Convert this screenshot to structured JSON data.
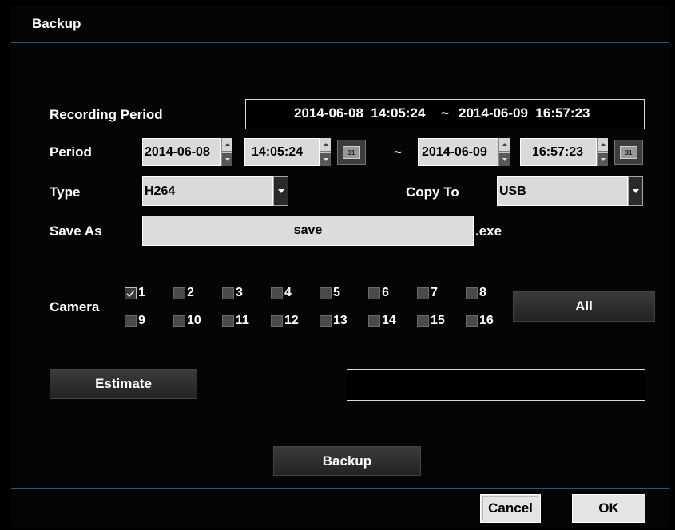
{
  "dialog": {
    "title": "Backup"
  },
  "recording_period": {
    "label": "Recording Period",
    "start": "2014-06-08  14:05:24",
    "sep": "~",
    "end": "2014-06-09  16:57:23"
  },
  "period": {
    "label": "Period",
    "start_date": "2014-06-08",
    "start_time": "14:05:24",
    "tilde": "~",
    "end_date": "2014-06-09",
    "end_time": "16:57:23",
    "calendar_glyph": "31"
  },
  "type": {
    "label": "Type",
    "value": "H264"
  },
  "copy_to": {
    "label": "Copy To",
    "value": "USB"
  },
  "save_as": {
    "label": "Save As",
    "value": "save",
    "ext": ".exe"
  },
  "camera": {
    "label": "Camera",
    "channels": [
      {
        "n": "1",
        "checked": true
      },
      {
        "n": "2",
        "checked": false
      },
      {
        "n": "3",
        "checked": false
      },
      {
        "n": "4",
        "checked": false
      },
      {
        "n": "5",
        "checked": false
      },
      {
        "n": "6",
        "checked": false
      },
      {
        "n": "7",
        "checked": false
      },
      {
        "n": "8",
        "checked": false
      },
      {
        "n": "9",
        "checked": false
      },
      {
        "n": "10",
        "checked": false
      },
      {
        "n": "11",
        "checked": false
      },
      {
        "n": "12",
        "checked": false
      },
      {
        "n": "13",
        "checked": false
      },
      {
        "n": "14",
        "checked": false
      },
      {
        "n": "15",
        "checked": false
      },
      {
        "n": "16",
        "checked": false
      }
    ],
    "all_label": "All"
  },
  "estimate": {
    "label": "Estimate",
    "result": ""
  },
  "buttons": {
    "backup": "Backup",
    "cancel": "Cancel",
    "ok": "OK"
  }
}
